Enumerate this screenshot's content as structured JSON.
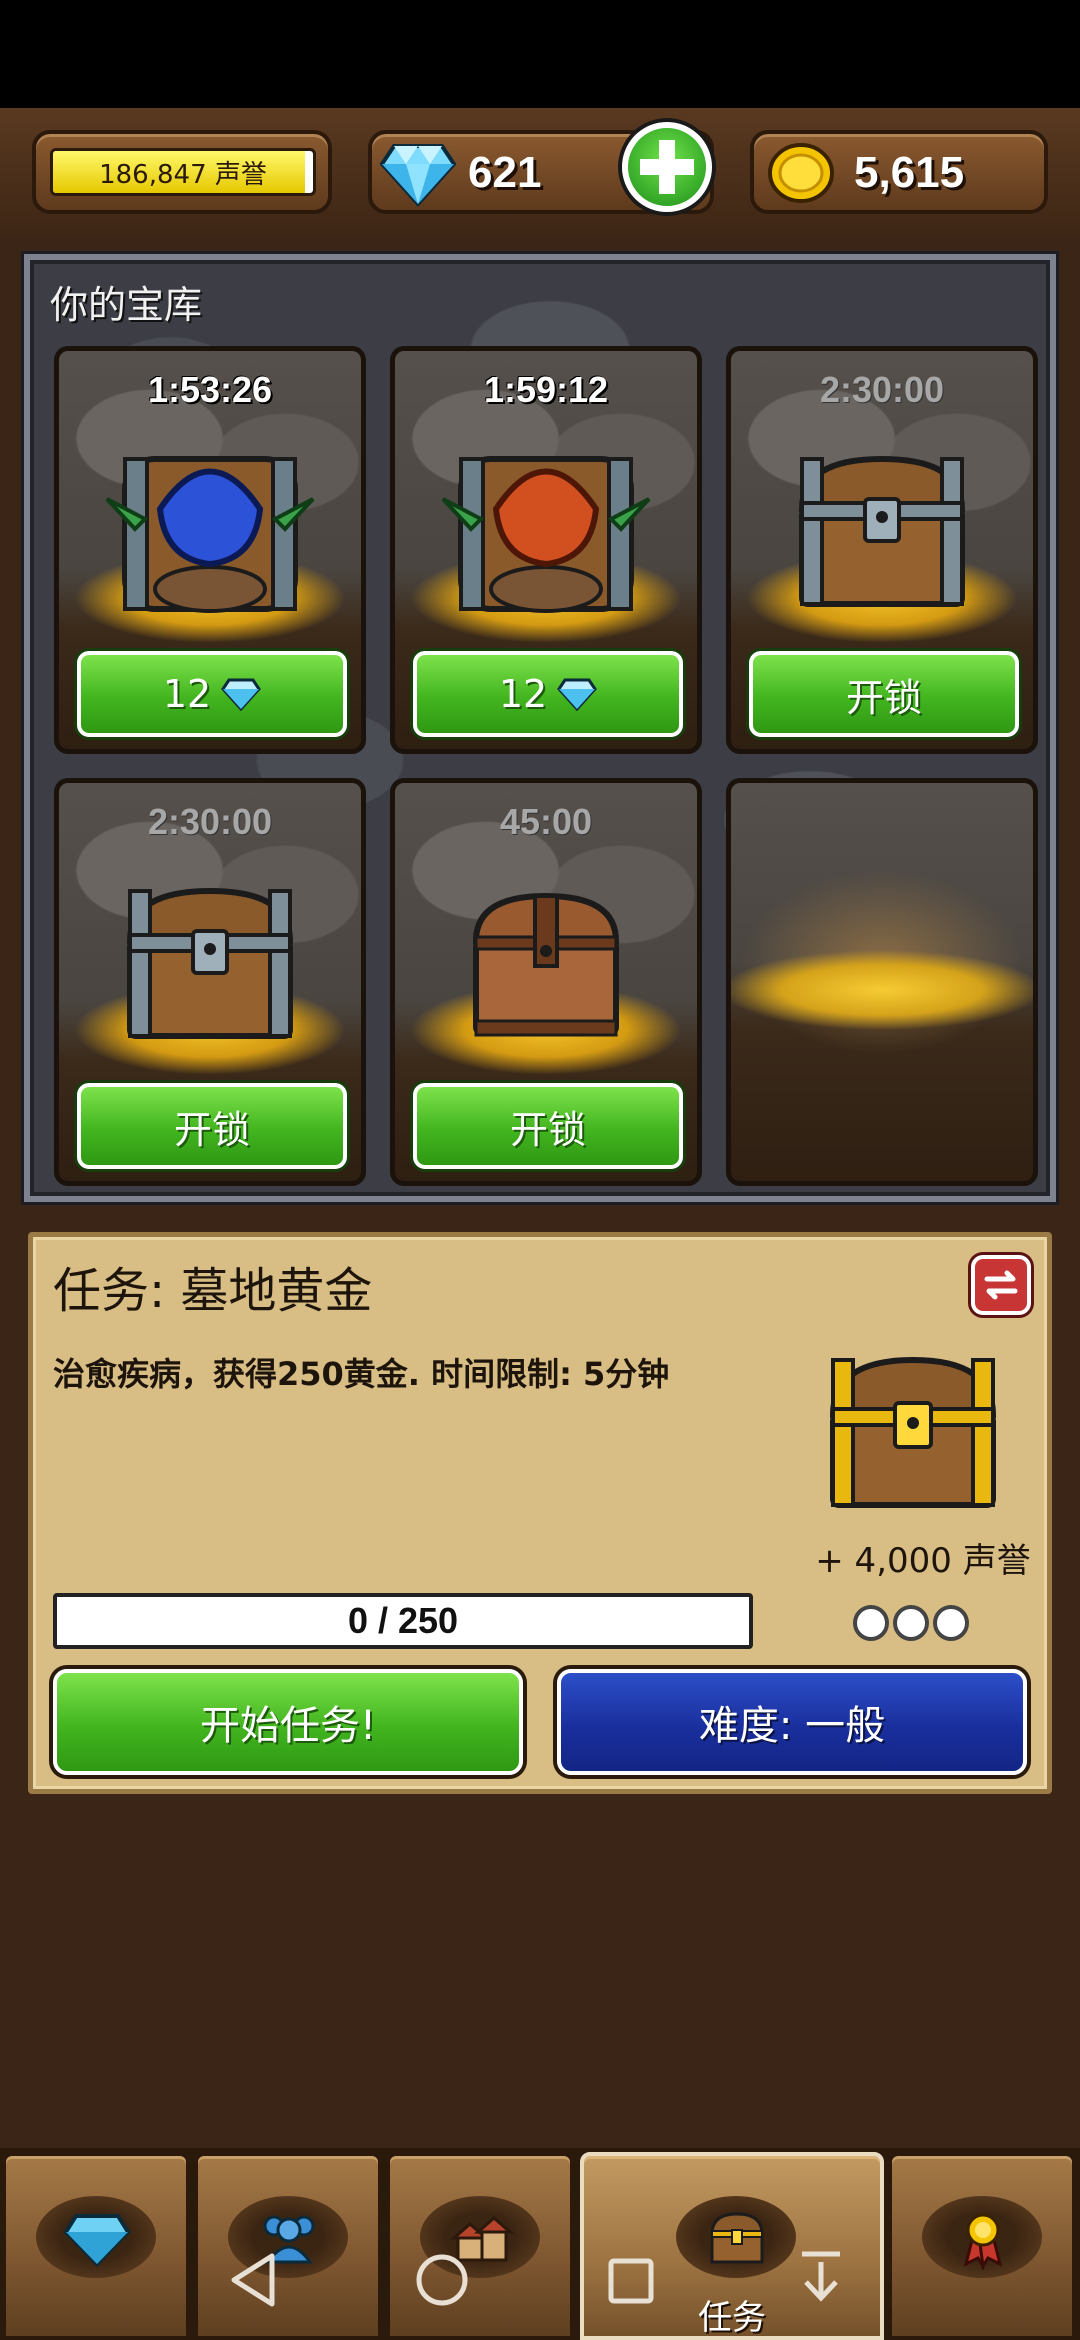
{
  "top_bar": {
    "reputation": {
      "value_text": "186,847 声誉",
      "fill_fraction": 0.97
    },
    "gems": {
      "value": "621",
      "add_icon": "plus-icon"
    },
    "gold": {
      "value": "5,615"
    }
  },
  "vault": {
    "title": "你的宝库",
    "slots": [
      {
        "timer": "1:53:26",
        "timer_active": true,
        "item": "blue-goblin-chest",
        "button_label": "12",
        "button_icon": "diamond-icon"
      },
      {
        "timer": "1:59:12",
        "timer_active": true,
        "item": "red-goblin-chest",
        "button_label": "12",
        "button_icon": "diamond-icon"
      },
      {
        "timer": "2:30:00",
        "timer_active": false,
        "item": "iron-chest",
        "button_label": "开锁"
      },
      {
        "timer": "2:30:00",
        "timer_active": false,
        "item": "iron-chest",
        "button_label": "开锁"
      },
      {
        "timer": "45:00",
        "timer_active": false,
        "item": "wooden-chest",
        "button_label": "开锁"
      },
      {
        "timer": "",
        "item": "empty-slot"
      }
    ]
  },
  "quest": {
    "title": "任务: 墓地黄金",
    "description": "治愈疾病，获得250黄金. 时间限制: 5分钟",
    "reward": "+ 4,000 声誉",
    "reward_icon": "gold-chest-icon",
    "difficulty_dots": 3,
    "progress": {
      "text": "0 / 250",
      "current": 0,
      "total": 250
    },
    "start_button": "开始任务!",
    "difficulty_button": "难度: 一般",
    "swap_icon": "swap-icon"
  },
  "bottom_nav": {
    "tabs": [
      {
        "icon": "diamond-icon",
        "label": ""
      },
      {
        "icon": "people-icon",
        "label": ""
      },
      {
        "icon": "buildings-icon",
        "label": ""
      },
      {
        "icon": "chest-icon",
        "label": "任务",
        "active": true
      },
      {
        "icon": "medal-icon",
        "label": ""
      }
    ]
  },
  "colors": {
    "accent_green": "#42b51f",
    "accent_blue": "#1a2f9e",
    "panel_tan": "#d8bd84",
    "background_brown": "#3b2517"
  }
}
